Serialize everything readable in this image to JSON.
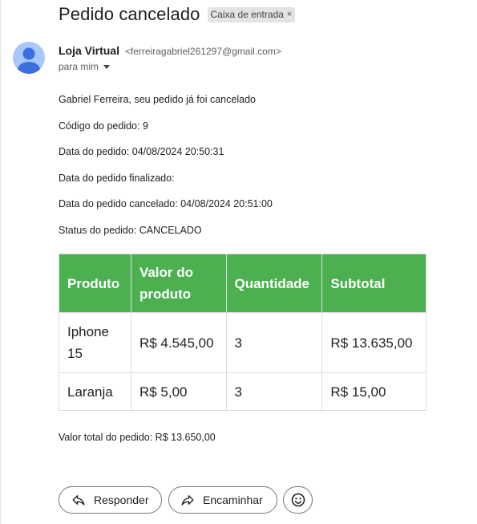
{
  "email": {
    "subject": "Pedido cancelado",
    "label": "Caixa de entrada",
    "label_remove_glyph": "×",
    "sender_name": "Loja Virtual",
    "sender_email": "<ferreiragabriel261297@gmail.com>",
    "recipient": "para mim",
    "avatar_color": "#a8c7fa",
    "lines": [
      "Gabriel Ferreira, seu pedido já foi cancelado",
      "Código do pedido: 9",
      "Data do pedido: 04/08/2024 20:50:31",
      "Data do pedido finalizado:",
      "Data do pedido cancelado: 04/08/2024 20:51:00",
      "Status do pedido: CANCELADO"
    ],
    "table": {
      "header_color": "#4caf50",
      "headers": [
        "Produto",
        "Valor do produto",
        "Quantidade",
        "Subtotal"
      ],
      "rows": [
        [
          "Iphone 15",
          "R$ 4.545,00",
          "3",
          "R$ 13.635,00"
        ],
        [
          "Laranja",
          "R$ 5,00",
          "3",
          "R$ 15,00"
        ]
      ]
    },
    "total": "Valor total do pedido: R$ 13.650,00"
  },
  "actions": {
    "reply_label": "Responder",
    "forward_label": "Encaminhar",
    "reply_icon": "reply-icon",
    "forward_icon": "forward-icon",
    "emoji_icon": "emoji-icon"
  }
}
